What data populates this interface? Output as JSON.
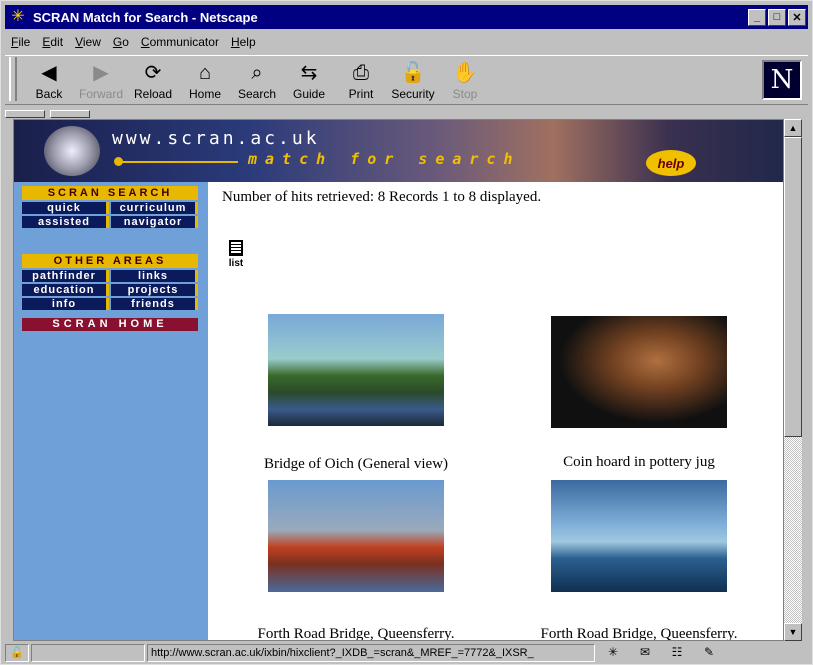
{
  "window": {
    "title": "SCRAN Match for Search - Netscape"
  },
  "menu": [
    "File",
    "Edit",
    "View",
    "Go",
    "Communicator",
    "Help"
  ],
  "toolbar": [
    {
      "label": "Back",
      "icon": "back-arrow-icon",
      "glyph": "◀",
      "enabled": true
    },
    {
      "label": "Forward",
      "icon": "forward-arrow-icon",
      "glyph": "▶",
      "enabled": false
    },
    {
      "label": "Reload",
      "icon": "reload-icon",
      "glyph": "⟳",
      "enabled": true
    },
    {
      "label": "Home",
      "icon": "home-icon",
      "glyph": "⌂",
      "enabled": true
    },
    {
      "label": "Search",
      "icon": "search-flashlight-icon",
      "glyph": "⌕",
      "enabled": true
    },
    {
      "label": "Guide",
      "icon": "guide-signpost-icon",
      "glyph": "⇆",
      "enabled": true
    },
    {
      "label": "Print",
      "icon": "print-icon",
      "glyph": "⎙",
      "enabled": true
    },
    {
      "label": "Security",
      "icon": "security-lock-icon",
      "glyph": "🔓",
      "enabled": true
    },
    {
      "label": "Stop",
      "icon": "stop-icon",
      "glyph": "✋",
      "enabled": false
    }
  ],
  "banner": {
    "site": "www.scran.ac.uk",
    "tagline": "match for search",
    "help": "help"
  },
  "sidebar": {
    "search_head": "SCRAN SEARCH",
    "search_links": [
      "quick",
      "curriculum",
      "assisted",
      "navigator"
    ],
    "other_head": "OTHER AREAS",
    "other_links": [
      "pathfinder",
      "links",
      "education",
      "projects",
      "info",
      "friends"
    ],
    "home": "SCRAN HOME"
  },
  "main": {
    "hits": "Number of hits retrieved: 8 Records  1 to 8  displayed.",
    "list_label": "list",
    "results": [
      {
        "caption": "Bridge of Oich (General view)"
      },
      {
        "caption": "Coin hoard in pottery jug"
      },
      {
        "caption": "Forth Road Bridge, Queensferry."
      },
      {
        "caption": "Forth Road Bridge, Queensferry."
      }
    ]
  },
  "status": {
    "url": "http://www.scran.ac.uk/ixbin/hixclient?_IXDB_=scran&_MREF_=7772&_IXSR_"
  }
}
